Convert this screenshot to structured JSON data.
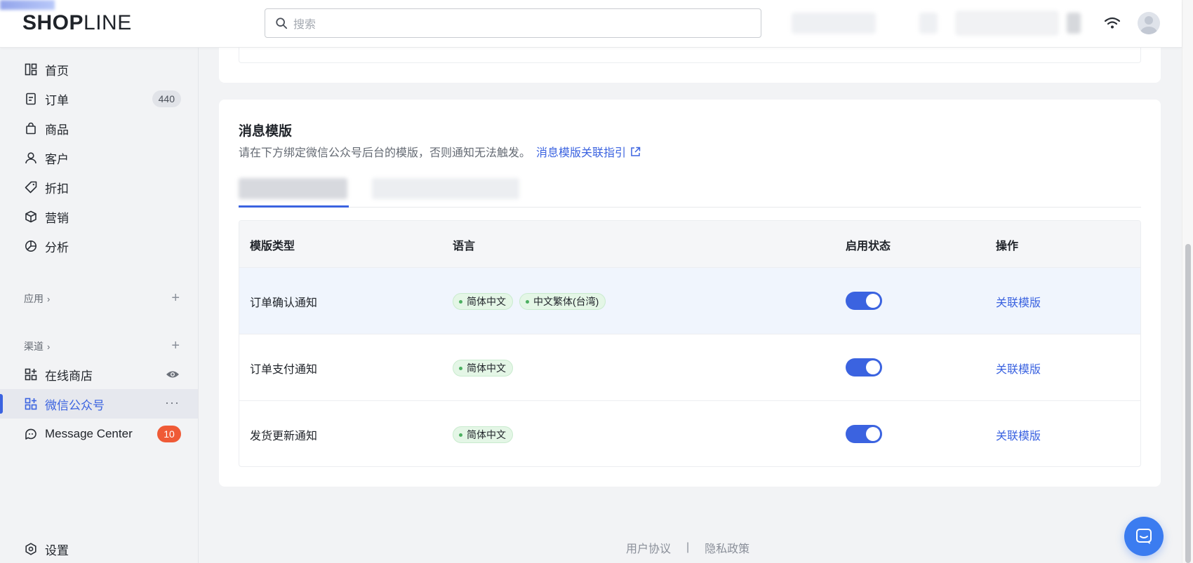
{
  "header": {
    "logo": {
      "bold": "SHOP",
      "thin": "LINE"
    },
    "search_placeholder": "搜索"
  },
  "sidebar": {
    "items": [
      {
        "label": "首页",
        "icon": "dashboard-icon"
      },
      {
        "label": "订单",
        "icon": "order-icon",
        "badge": "440"
      },
      {
        "label": "商品",
        "icon": "bag-icon"
      },
      {
        "label": "客户",
        "icon": "user-icon"
      },
      {
        "label": "折扣",
        "icon": "tag-icon"
      },
      {
        "label": "营销",
        "icon": "cube-icon"
      },
      {
        "label": "分析",
        "icon": "chart-pie-icon"
      }
    ],
    "apps_label": "应用",
    "channels_label": "渠道",
    "channels": [
      {
        "label": "在线商店",
        "icon": "store-icon"
      },
      {
        "label": "微信公众号",
        "icon": "store-icon",
        "active": true
      },
      {
        "label": "Message Center",
        "icon": "chat-icon",
        "badge": "10"
      }
    ],
    "settings_label": "设置"
  },
  "main": {
    "section_title": "消息模版",
    "description": "请在下方绑定微信公众号后台的模版，否则通知无法触发。",
    "guide_link": "消息模版关联指引",
    "table": {
      "headers": [
        "模版类型",
        "语言",
        "启用状态",
        "操作"
      ],
      "rows": [
        {
          "type": "订单确认通知",
          "languages": [
            "简体中文",
            "中文繁体(台湾)"
          ],
          "enabled": true,
          "action": "关联模版"
        },
        {
          "type": "订单支付通知",
          "languages": [
            "简体中文"
          ],
          "enabled": true,
          "action": "关联模版"
        },
        {
          "type": "发货更新通知",
          "languages": [
            "简体中文"
          ],
          "enabled": true,
          "action": "关联模版"
        }
      ]
    }
  },
  "footer": {
    "terms": "用户协议",
    "separator": "|",
    "privacy": "隐私政策"
  },
  "colors": {
    "accent": "#3b63e0",
    "tag_bg": "#e4f6e6",
    "badge_red": "#ef5a36",
    "chat_button": "#3b7cf0"
  }
}
